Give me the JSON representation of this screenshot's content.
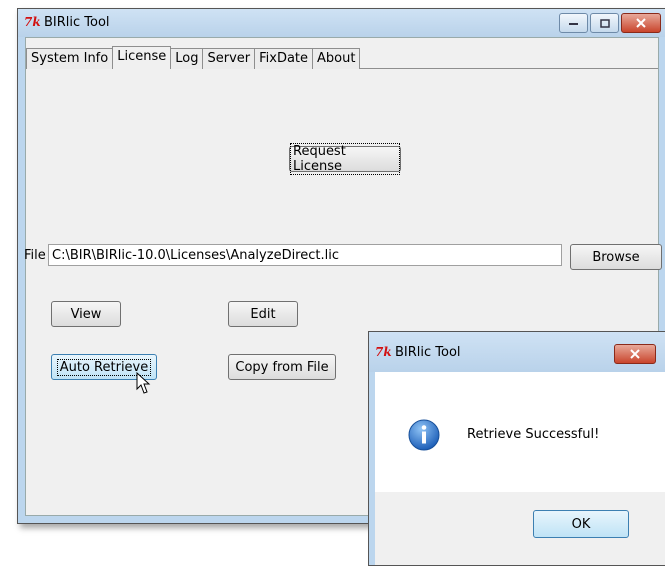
{
  "window": {
    "logo": "7k",
    "title": "BIRlic Tool",
    "tabs": [
      "System Info",
      "License",
      "Log",
      "Server",
      "FixDate",
      "About"
    ],
    "active_tab": "License"
  },
  "license": {
    "request_button": "Request License",
    "file_label": "File",
    "file_path": "C:\\BIR\\BIRlic-10.0\\Licenses\\AnalyzeDirect.lic",
    "browse_button": "Browse",
    "view_button": "View",
    "edit_button": "Edit",
    "auto_retrieve_button": "Auto Retrieve",
    "copy_from_file_button": "Copy from File"
  },
  "dialog": {
    "logo": "7k",
    "title": "BIRlic Tool",
    "message": "Retrieve Successful!",
    "ok_button": "OK",
    "icon": "info-icon"
  },
  "colors": {
    "titlebar": "#bcd6ee",
    "close_button": "#c9452c",
    "logo_red": "#d21010",
    "info_blue": "#1d5fb8"
  }
}
